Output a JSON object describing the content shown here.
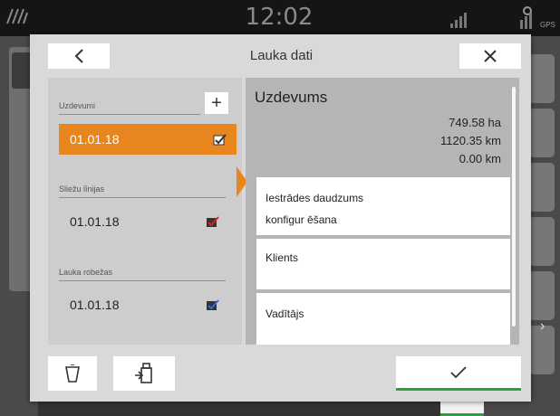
{
  "background": {
    "clock": "12:02",
    "gps_label": "GPS"
  },
  "dialog": {
    "title": "Lauka dati",
    "back_icon": "chevron-left-icon",
    "close_icon": "close-icon"
  },
  "left_list": {
    "sections": [
      {
        "label": "Uzdevumi",
        "has_add_button": true,
        "add_label": "+",
        "items": [
          {
            "label": "01.01.18",
            "selected": true,
            "icon": "checkbox-checked-icon"
          }
        ]
      },
      {
        "label": "Sliežu līnijas",
        "items": [
          {
            "label": "01.01.18",
            "selected": false,
            "icon": "checkbox-checked-red-icon"
          }
        ]
      },
      {
        "label": "Lauka robežas",
        "items": [
          {
            "label": "01.01.18",
            "selected": false,
            "icon": "checkbox-checked-blue-icon"
          }
        ]
      }
    ]
  },
  "details": {
    "title": "Uzdevums",
    "values": [
      "749.58 ha",
      "1120.35 km",
      "0.00 km"
    ],
    "cards": [
      {
        "line1": "Iestrādes daudzums",
        "line2": "konfigur ēšana"
      },
      {
        "line1": "Klients"
      },
      {
        "line1": "Vadītājs"
      }
    ]
  },
  "footer": {
    "delete_icon": "trash-icon",
    "export_icon": "usb-export-icon",
    "confirm_icon": "checkmark-icon"
  },
  "colors": {
    "accent_orange": "#e9851d",
    "confirm_green": "#2aa33a",
    "panel_gray": "#cdcdcd",
    "detail_gray": "#b5b5b5"
  }
}
